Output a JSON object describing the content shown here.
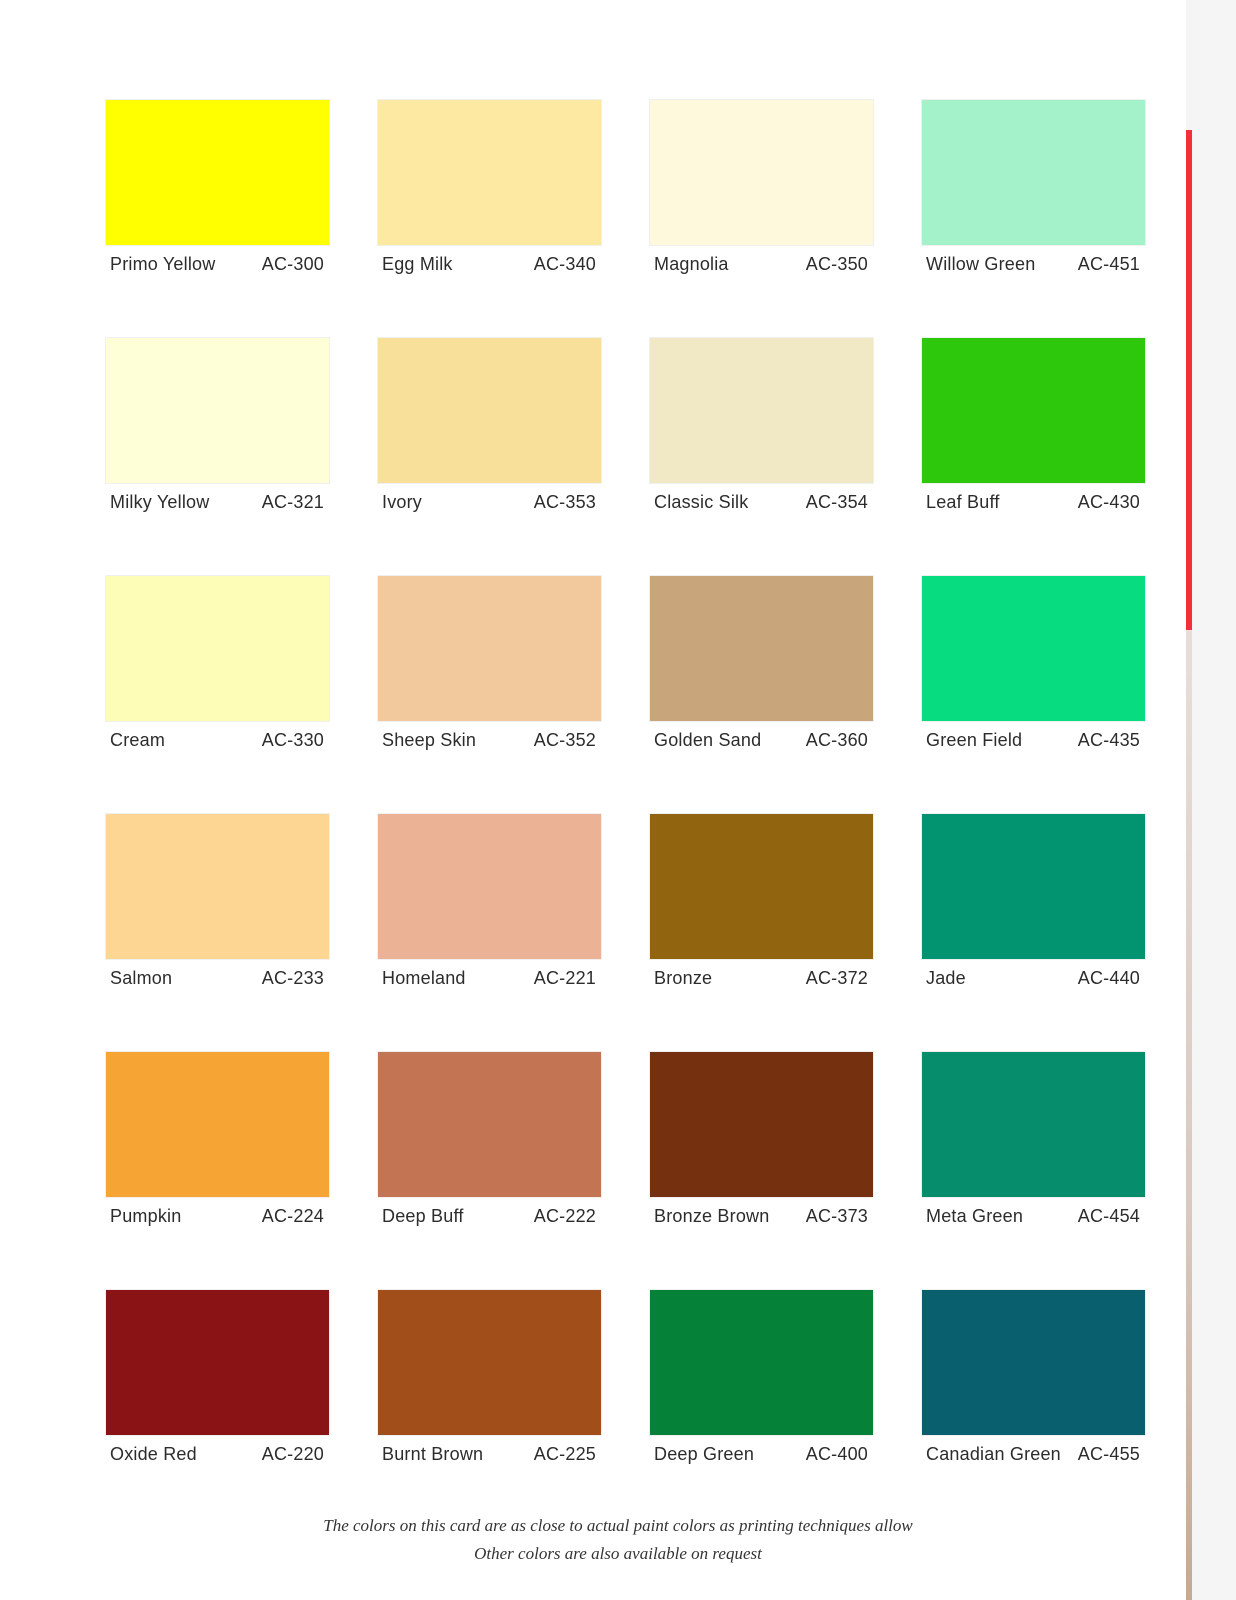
{
  "swatches": [
    {
      "name": "Primo Yellow",
      "code": "AC-300",
      "color": "#ffff00"
    },
    {
      "name": "Egg Milk",
      "code": "AC-340",
      "color": "#fde9a2"
    },
    {
      "name": "Magnolia",
      "code": "AC-350",
      "color": "#fef9dc"
    },
    {
      "name": "Willow Green",
      "code": "AC-451",
      "color": "#a4f2ca"
    },
    {
      "name": "Milky Yellow",
      "code": "AC-321",
      "color": "#fefed7"
    },
    {
      "name": "Ivory",
      "code": "AC-353",
      "color": "#f8e09a"
    },
    {
      "name": "Classic Silk",
      "code": "AC-354",
      "color": "#f1e8c6"
    },
    {
      "name": "Leaf Buff",
      "code": "AC-430",
      "color": "#2dc80b"
    },
    {
      "name": "Cream",
      "code": "AC-330",
      "color": "#fefdb8"
    },
    {
      "name": "Sheep Skin",
      "code": "AC-352",
      "color": "#f2c89d"
    },
    {
      "name": "Golden Sand",
      "code": "AC-360",
      "color": "#c8a57b"
    },
    {
      "name": "Green Field",
      "code": "AC-435",
      "color": "#08dc80"
    },
    {
      "name": "Salmon",
      "code": "AC-233",
      "color": "#fed694"
    },
    {
      "name": "Homeland",
      "code": "AC-221",
      "color": "#ebb296"
    },
    {
      "name": "Bronze",
      "code": "AC-372",
      "color": "#916410"
    },
    {
      "name": "Jade",
      "code": "AC-440",
      "color": "#029470"
    },
    {
      "name": "Pumpkin",
      "code": "AC-224",
      "color": "#f6a535"
    },
    {
      "name": "Deep Buff",
      "code": "AC-222",
      "color": "#c37452"
    },
    {
      "name": "Bronze Brown",
      "code": "AC-373",
      "color": "#74300f"
    },
    {
      "name": "Meta Green",
      "code": "AC-454",
      "color": "#058d6c"
    },
    {
      "name": "Oxide Red",
      "code": "AC-220",
      "color": "#8a1415"
    },
    {
      "name": "Burnt Brown",
      "code": "AC-225",
      "color": "#a24e1b"
    },
    {
      "name": "Deep Green",
      "code": "AC-400",
      "color": "#058138"
    },
    {
      "name": "Canadian Green",
      "code": "AC-455",
      "color": "#095f6d"
    }
  ],
  "footer": {
    "line1": "The colors on this card are as close to actual paint colors as printing techniques allow",
    "line2": "Other colors are also available on request"
  },
  "theme": {
    "edge_accent": "#f2303a",
    "text": "#2c2c2c"
  }
}
